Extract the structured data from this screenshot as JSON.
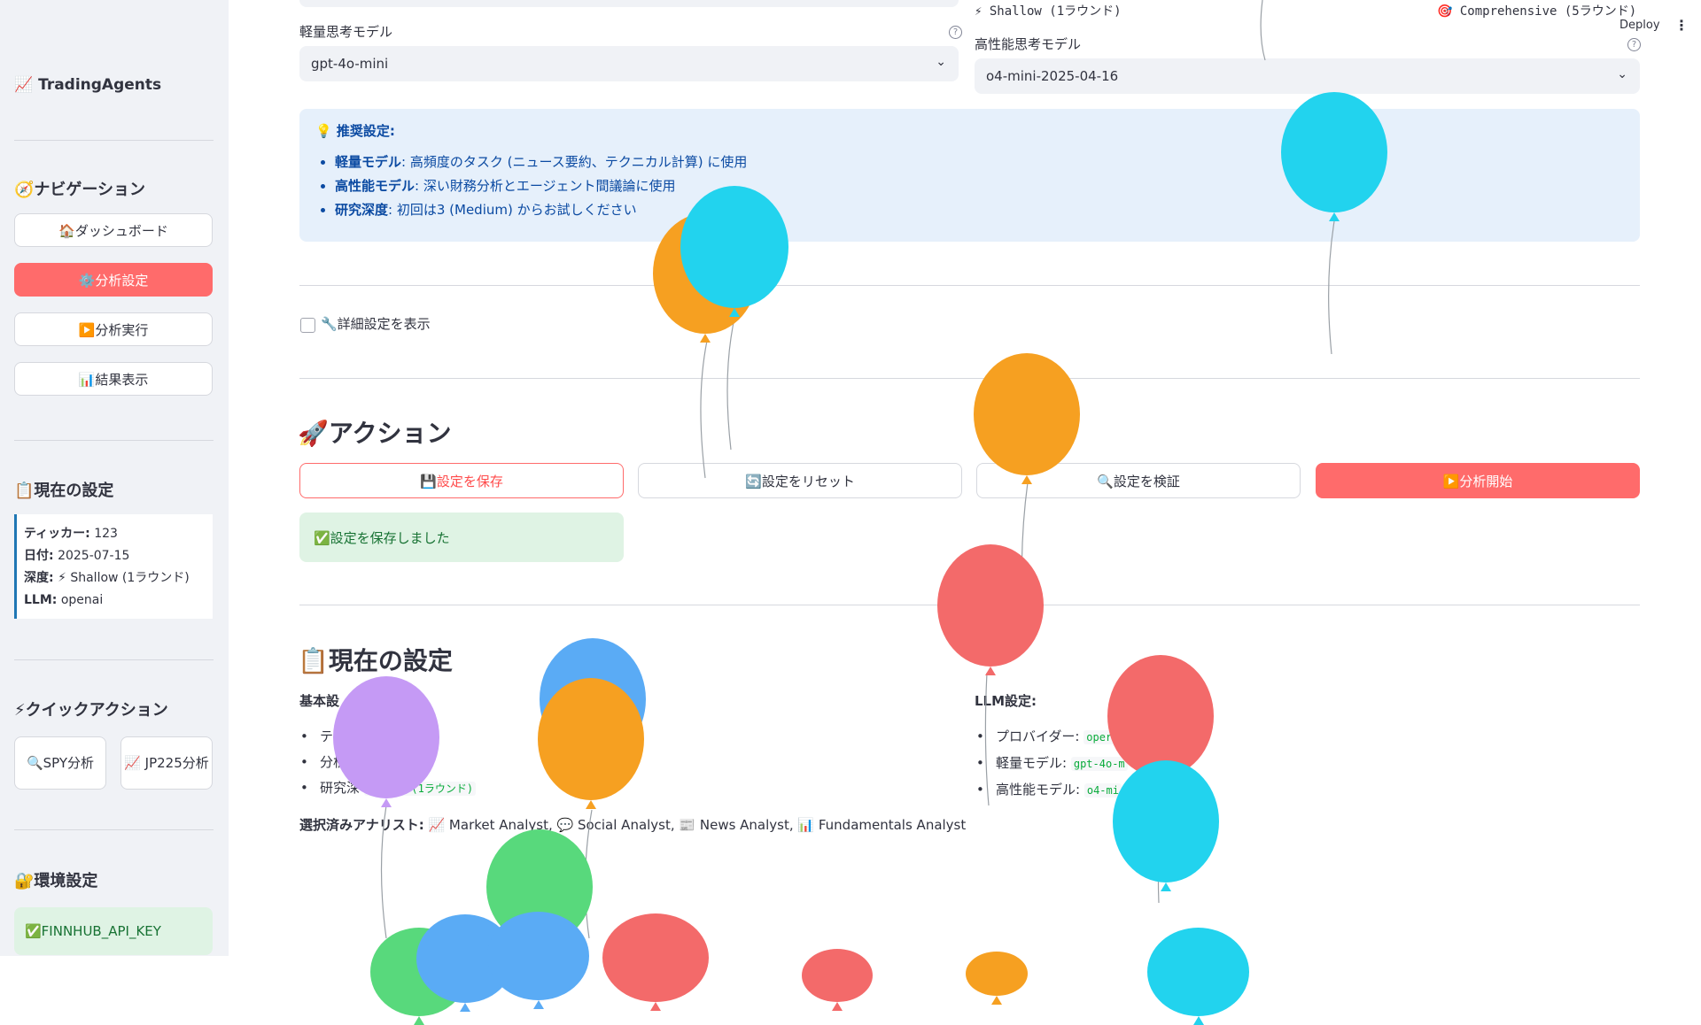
{
  "sidebar": {
    "app_name": "📈 TradingAgents",
    "nav_title": "🧭ナビゲーション",
    "nav_items": [
      {
        "label": "🏠ダッシュボード"
      },
      {
        "label": "⚙️分析設定"
      },
      {
        "label": "▶️分析実行"
      },
      {
        "label": "📊結果表示"
      }
    ],
    "current_settings_title": "📋現在の設定",
    "current_settings": {
      "ticker_label": "ティッカー:",
      "ticker": "123",
      "date_label": "日付:",
      "date": "2025-07-15",
      "depth_label": "深度:",
      "depth": "⚡ Shallow (1ラウンド)",
      "llm_label": "LLM:",
      "llm": "openai"
    },
    "quick_title": "⚡クイックアクション",
    "quick_spy": "🔍SPY分析",
    "quick_jp": "📈 JP225分析",
    "env_title": "🔐環境設定",
    "env_key": "✅FINNHUB_API_KEY"
  },
  "header": {
    "deploy": "Deploy",
    "menu": "⋮"
  },
  "depth_options": {
    "shallow": "⚡ Shallow (1ラウンド)",
    "comprehensive": "🎯 Comprehensive (5ラウンド)"
  },
  "models": {
    "light_label": "軽量思考モデル",
    "light_value": "gpt-4o-mini",
    "heavy_label": "高性能思考モデル",
    "heavy_value": "o4-mini-2025-04-16"
  },
  "info": {
    "title": "💡 推奨設定:",
    "items": [
      {
        "key": "軽量モデル",
        "text": ": 高頻度のタスク (ニュース要約、テクニカル計算) に使用"
      },
      {
        "key": "高性能モデル",
        "text": ": 深い財務分析とエージェント間議論に使用"
      },
      {
        "key": "研究深度",
        "text": ": 初回は3 (Medium) からお試しください"
      }
    ]
  },
  "advanced_toggle": "🔧詳細設定を表示",
  "actions": {
    "title": "🚀アクション",
    "save": "💾設定を保存",
    "reset": "🔄設定をリセット",
    "verify": "🔍設定を検証",
    "start": "▶️分析開始",
    "saved_msg": "✅設定を保存しました"
  },
  "current": {
    "title": "📋現在の設定",
    "basic_label": "基本設",
    "basic_items": [
      "テ",
      "分析",
      "研究深"
    ],
    "basic_depth_code": "hallow (1ラウンド)",
    "llm_label": "LLM設定:",
    "llm_items": [
      {
        "label": "プロバイダー:",
        "code": "oper"
      },
      {
        "label": "軽量モデル:",
        "code": "gpt-4o-m"
      },
      {
        "label": "高性能モデル:",
        "code": "o4-mi"
      }
    ],
    "analysts_label": "選択済みアナリスト:",
    "analysts": "📈 Market Analyst, 💬 Social Analyst, 📰 News Analyst, 📊 Fundamentals Analyst"
  },
  "colors": {
    "primary": "#ff6b6b",
    "info_bg": "#e6f0fb",
    "success_bg": "#dff3e4",
    "balloon_cyan": "#22d3ee",
    "balloon_orange": "#f6a021",
    "balloon_red": "#f36a6a",
    "balloon_blue": "#5aabf5",
    "balloon_purple": "#c59af5",
    "balloon_green": "#58d97c"
  }
}
